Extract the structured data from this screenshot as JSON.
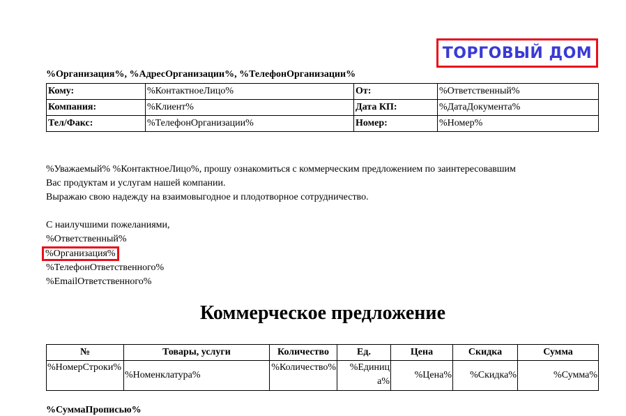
{
  "logo": {
    "text": "ТОРГОВЫЙ ДОМ"
  },
  "header_line": "%Организация%, %АдресОрганизации%, %ТелефонОрганизации%",
  "info_table": {
    "rows": [
      {
        "label1": "Кому:",
        "value1": "%КонтактноеЛицо%",
        "label2": "От:",
        "value2": "%Ответственный%"
      },
      {
        "label1": "Компания:",
        "value1": "%Клиент%",
        "label2": "Дата КП:",
        "value2": "%ДатаДокумента%"
      },
      {
        "label1": "Тел/Факс:",
        "value1": "%ТелефонОрганизации%",
        "label2": "Номер:",
        "value2": "%Номер%"
      }
    ]
  },
  "letter": {
    "line1": "%Уважаемый% %КонтактноеЛицо%, прошу ознакомиться с коммерческим предложением по заинтересовавшим",
    "line2": "Вас продуктам и услугам нашей компании.",
    "line3": "Выражаю свою надежду на взаимовыгодное и плодотворное сотрудничество.",
    "closing": "С наилучшими пожеланиями,",
    "responsible": "%Ответственный%",
    "organization": "%Организация%",
    "phone": "%ТелефонОтветственного%",
    "email": "%EmailОтветственного%"
  },
  "title": "Коммерческое предложение",
  "goods_table": {
    "headers": [
      "№",
      "Товары, услуги",
      "Количество",
      "Ед.",
      "Цена",
      "Скидка",
      "Сумма"
    ],
    "row": [
      "%НомерСтроки%",
      "%Номенклатура%",
      "%Количество%",
      "%Единица%",
      "%Цена%",
      "%Скидка%",
      "%Сумма%"
    ]
  },
  "cut_text": "%СуммаПрописью%"
}
